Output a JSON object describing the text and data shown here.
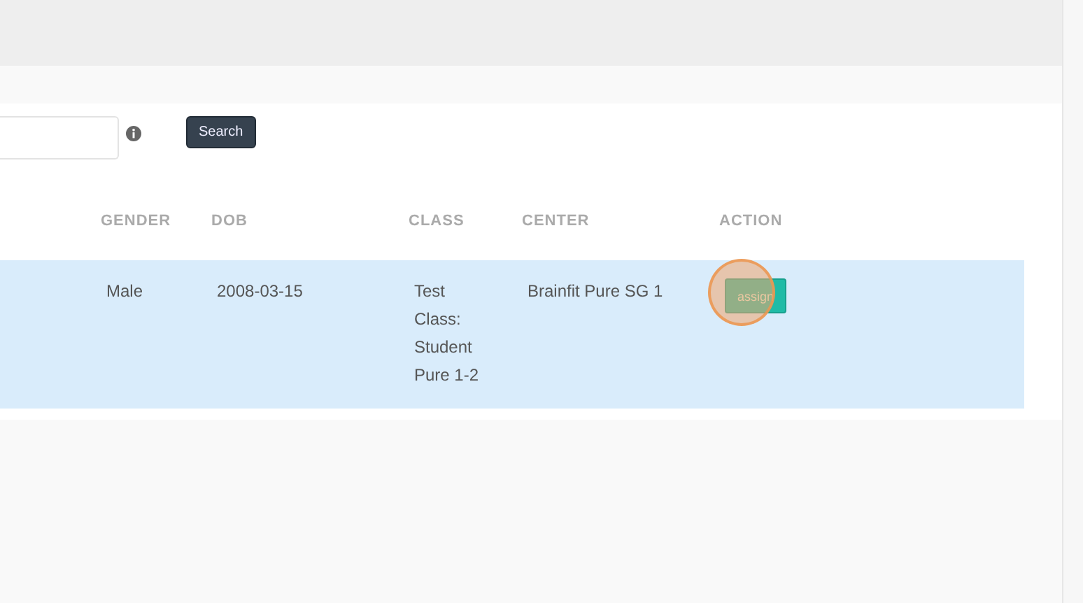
{
  "search": {
    "button": "Search"
  },
  "table": {
    "columns": [
      "GENDER",
      "DOB",
      "CLASS",
      "CENTER",
      "ACTION"
    ],
    "rows": [
      {
        "selected": true,
        "gender": "Male",
        "dob": "2008-03-15",
        "class": "Test Class: Student Pure 1-2",
        "center": "Brainfit Pure SG 1",
        "action": "assign"
      }
    ]
  }
}
